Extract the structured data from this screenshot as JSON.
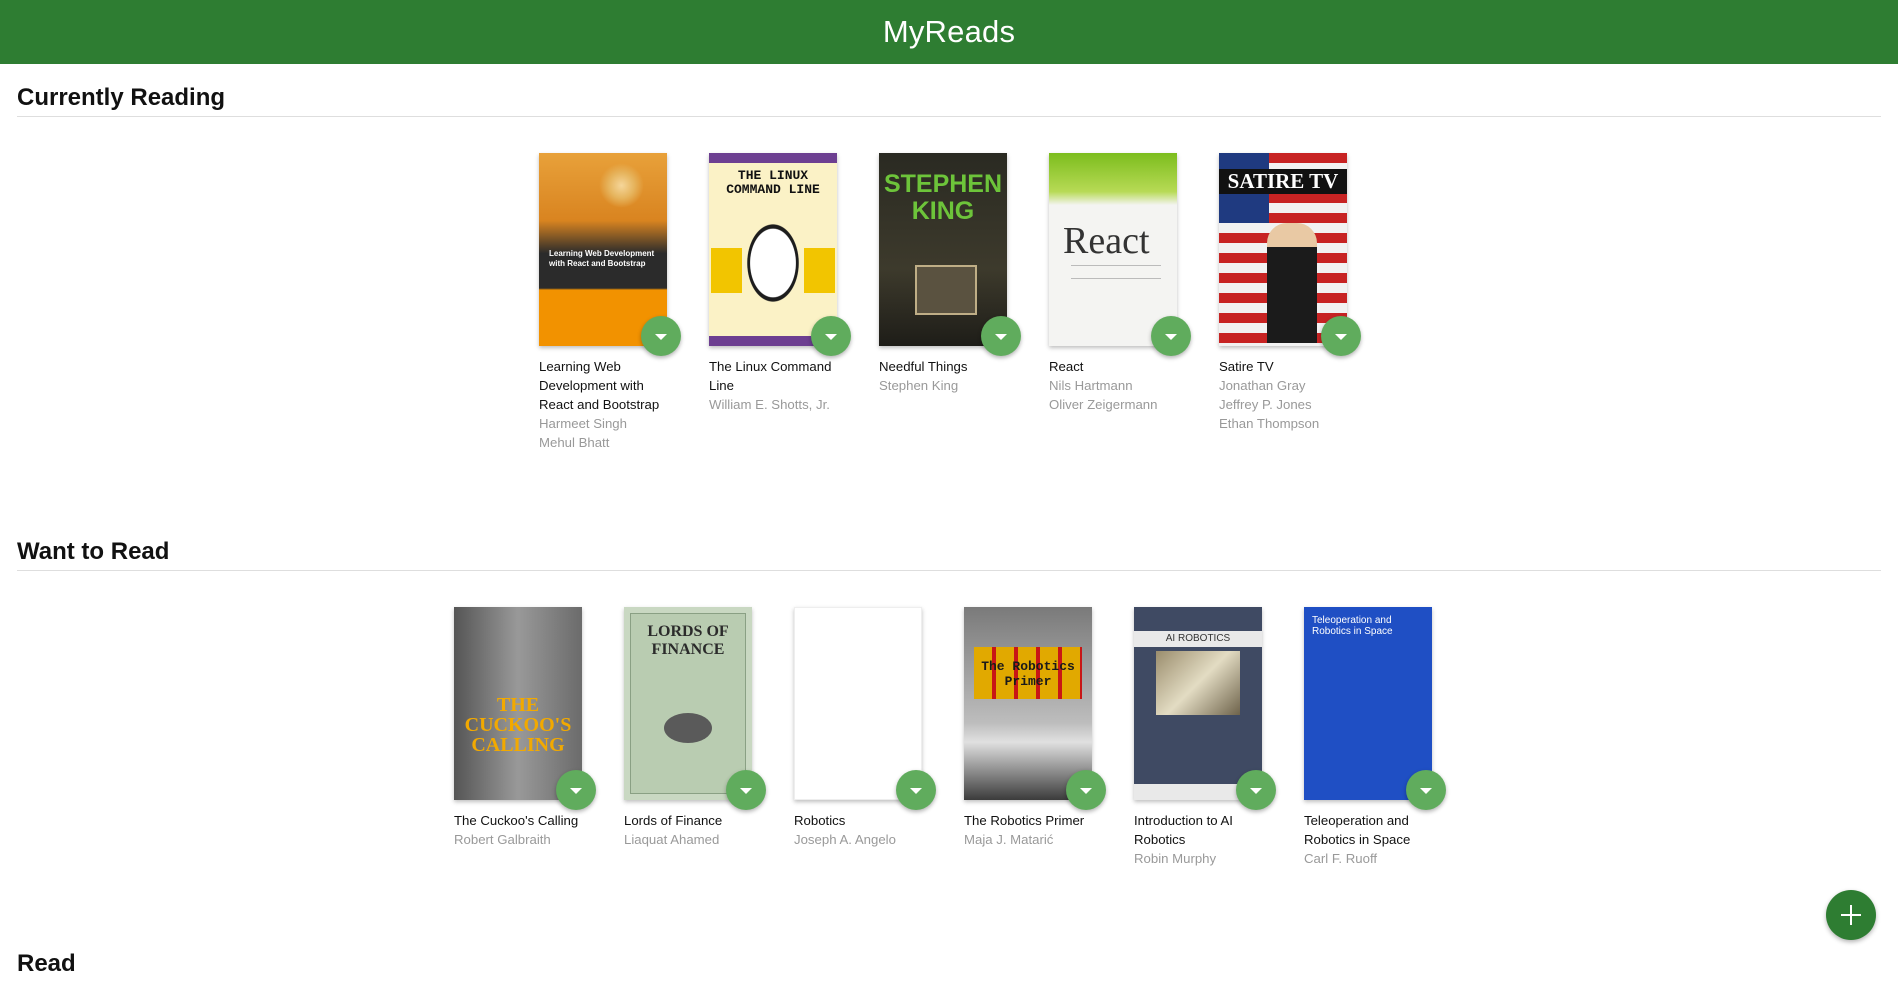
{
  "app": {
    "title": "MyReads"
  },
  "colors": {
    "header": "#2e7d32",
    "shelf_changer": "#60ac5d",
    "add_button": "#2e7d32"
  },
  "shelves": [
    {
      "title": "Currently Reading",
      "books": [
        {
          "title": "Learning Web Development with React and Bootstrap",
          "authors": [
            "Harmeet Singh",
            "Mehul Bhatt"
          ],
          "cover_text": "Learning Web Development with React and Bootstrap"
        },
        {
          "title": "The Linux Command Line",
          "authors": [
            "William E. Shotts, Jr."
          ],
          "cover_text": "THE LINUX COMMAND LINE"
        },
        {
          "title": "Needful Things",
          "authors": [
            "Stephen King"
          ],
          "cover_text": "STEPHEN KING"
        },
        {
          "title": "React",
          "authors": [
            "Nils Hartmann",
            "Oliver Zeigermann"
          ],
          "cover_text": "React"
        },
        {
          "title": "Satire TV",
          "authors": [
            "Jonathan Gray",
            "Jeffrey P. Jones",
            "Ethan Thompson"
          ],
          "cover_text": "SATIRE TV"
        }
      ]
    },
    {
      "title": "Want to Read",
      "books": [
        {
          "title": "The Cuckoo's Calling",
          "authors": [
            "Robert Galbraith"
          ],
          "cover_text": "THE CUCKOO'S CALLING"
        },
        {
          "title": "Lords of Finance",
          "authors": [
            "Liaquat Ahamed"
          ],
          "cover_text": "LORDS OF FINANCE"
        },
        {
          "title": "Robotics",
          "authors": [
            "Joseph A. Angelo"
          ],
          "cover_text": ""
        },
        {
          "title": "The Robotics Primer",
          "authors": [
            "Maja J. Matarić"
          ],
          "cover_text": "The Robotics Primer"
        },
        {
          "title": "Introduction to AI Robotics",
          "authors": [
            "Robin Murphy"
          ],
          "cover_text": "AI ROBOTICS"
        },
        {
          "title": "Teleoperation and Robotics in Space",
          "authors": [
            "Carl F. Ruoff"
          ],
          "cover_text": "Teleoperation and Robotics in Space"
        }
      ]
    },
    {
      "title": "Read",
      "books": []
    }
  ]
}
